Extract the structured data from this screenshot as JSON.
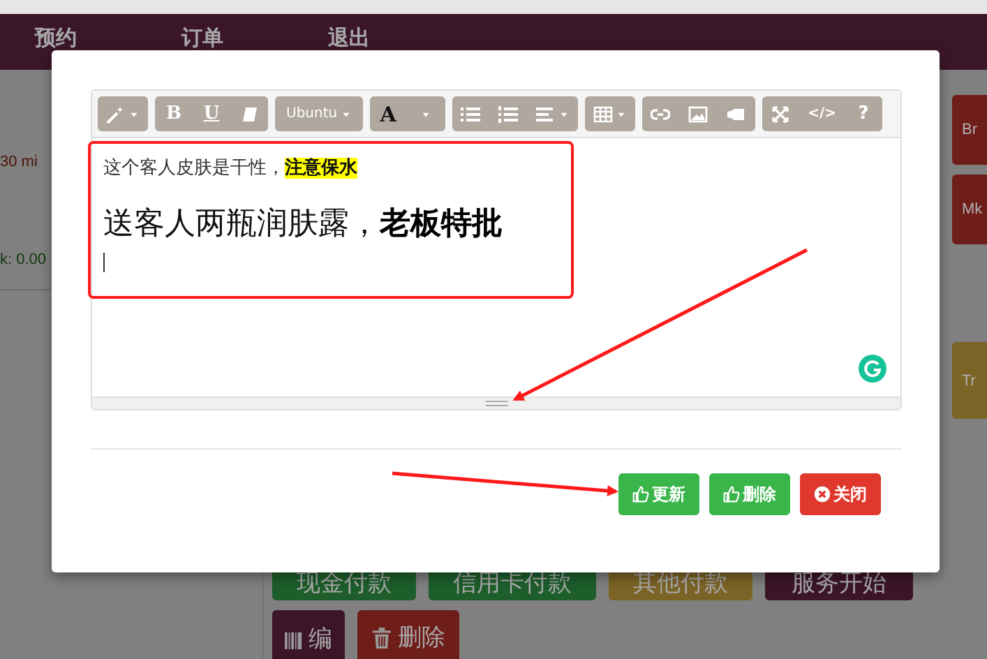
{
  "nav": [
    {
      "label": "预约"
    },
    {
      "label": "订单"
    },
    {
      "label": "退出"
    }
  ],
  "left_panel": [
    {
      "text": "30 mi",
      "kind": "duration"
    },
    {
      "text": "k: 0.00",
      "kind": "total"
    }
  ],
  "side_buttons": [
    {
      "label": "Br",
      "color": "#6f1d19"
    },
    {
      "label": "Mk",
      "color": "#6f1d19"
    },
    {
      "label": "Tr",
      "color": "#7c6326"
    }
  ],
  "action_buttons": [
    {
      "label": "现金付款",
      "color": "#1d5e2b",
      "kind": "plain"
    },
    {
      "label": "信用卡付款",
      "color": "#1d5e2b",
      "kind": "plain"
    },
    {
      "label": "其他付款",
      "color": "#7c6326",
      "kind": "plain"
    },
    {
      "label": "服务开始",
      "color": "#3c1529",
      "kind": "plain"
    },
    {
      "label": "编",
      "color": "#3c1529",
      "kind": "barcode"
    },
    {
      "label": "删除",
      "color": "#6f1d19",
      "kind": "trash"
    }
  ],
  "modal": {
    "toolbar": [
      [
        {
          "kind": "magic"
        }
      ],
      [
        {
          "kind": "bold",
          "label": "B"
        },
        {
          "kind": "underline",
          "label": "U"
        },
        {
          "kind": "eraser"
        }
      ],
      [
        {
          "kind": "font",
          "label": "Ubuntu"
        }
      ],
      [
        {
          "kind": "color",
          "label": "A"
        },
        {
          "kind": "colorcaret"
        }
      ],
      [
        {
          "kind": "ul"
        },
        {
          "kind": "ol"
        },
        {
          "kind": "align"
        }
      ],
      [
        {
          "kind": "table"
        }
      ],
      [
        {
          "kind": "link"
        },
        {
          "kind": "image"
        },
        {
          "kind": "video"
        }
      ],
      [
        {
          "kind": "fullscreen"
        },
        {
          "kind": "code",
          "label": "</>"
        },
        {
          "kind": "help",
          "label": "?"
        }
      ]
    ],
    "paragraphs": [
      {
        "text": "这个客人皮肤是干性，**注意保水**",
        "kind": "normal"
      },
      {
        "text": "送客人两瓶润肤露，**老板特批**",
        "kind": "large"
      }
    ],
    "buttons": [
      {
        "label": "更新",
        "color": "#3ab54a",
        "kind": "thumb"
      },
      {
        "label": "删除",
        "color": "#3ab54a",
        "kind": "thumb"
      },
      {
        "label": "关闭",
        "color": "#e0382c",
        "kind": "close"
      }
    ]
  }
}
